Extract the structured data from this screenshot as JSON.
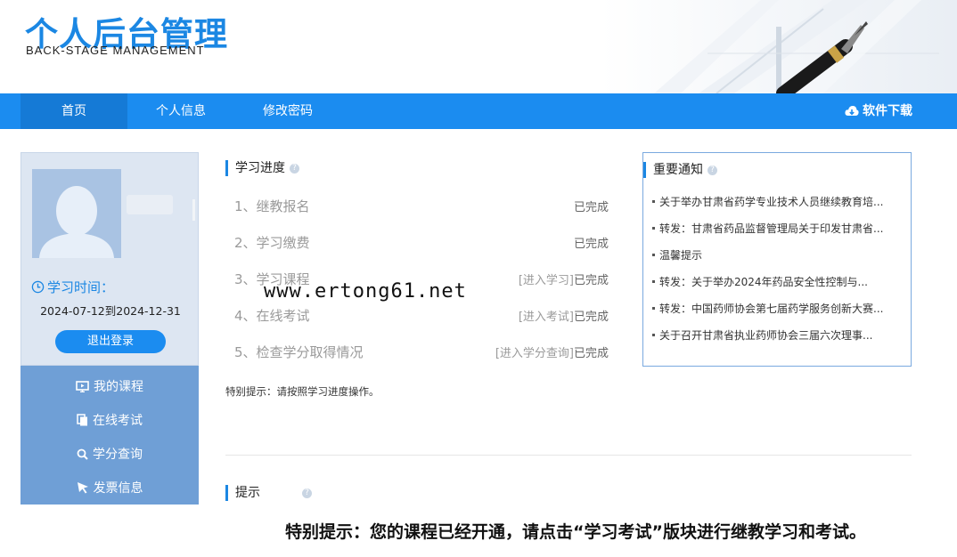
{
  "header": {
    "logo_cn": "个人后台管理",
    "logo_en": "BACK-STAGE   MANAGEMENT"
  },
  "nav": {
    "items": [
      {
        "label": "首页",
        "active": true
      },
      {
        "label": "个人信息",
        "active": false
      },
      {
        "label": "修改密码",
        "active": false
      }
    ],
    "download_label": "软件下载"
  },
  "sidebar": {
    "study_time_label": "学习时间：",
    "study_dates": "2024-07-12到2024-12-31",
    "logout_label": "退出登录",
    "menu": [
      {
        "label": "我的课程",
        "icon": "monitor-icon"
      },
      {
        "label": "在线考试",
        "icon": "copy-icon"
      },
      {
        "label": "学分查询",
        "icon": "search-icon"
      },
      {
        "label": "发票信息",
        "icon": "cursor-icon"
      }
    ]
  },
  "progress": {
    "title": "学习进度",
    "steps": [
      {
        "label": "1、继教报名",
        "link": "",
        "status": "已完成"
      },
      {
        "label": "2、学习缴费",
        "link": "",
        "status": "已完成"
      },
      {
        "label": "3、学习课程",
        "link": "[进入学习]",
        "status": "已完成"
      },
      {
        "label": "4、在线考试",
        "link": "[进入考试]",
        "status": "已完成"
      },
      {
        "label": "5、检查学分取得情况",
        "link": "[进入学分查询]",
        "status": "已完成"
      }
    ],
    "tip": "特别提示：请按照学习进度操作。"
  },
  "notice": {
    "title": "重要通知",
    "items": [
      "关于举办甘肃省药学专业技术人员继续教育培...",
      "转发：甘肃省药品监督管理局关于印发甘肃省...",
      "温馨提示",
      "转发：关于举办2024年药品安全性控制与...",
      "转发：中国药师协会第七届药学服务创新大赛...",
      "关于召开甘肃省执业药师协会三届六次理事..."
    ]
  },
  "hint": {
    "title": "提示",
    "message": "特别提示：您的课程已经开通，请点击“学习考试”版块进行继教学习和考试。"
  },
  "watermark": "www.ertong61.net",
  "colors": {
    "brand_blue": "#1b8cf0",
    "logo_blue": "#1b87e3",
    "menu_bg": "#6f9fd6",
    "profile_bg": "#dde6f2"
  }
}
